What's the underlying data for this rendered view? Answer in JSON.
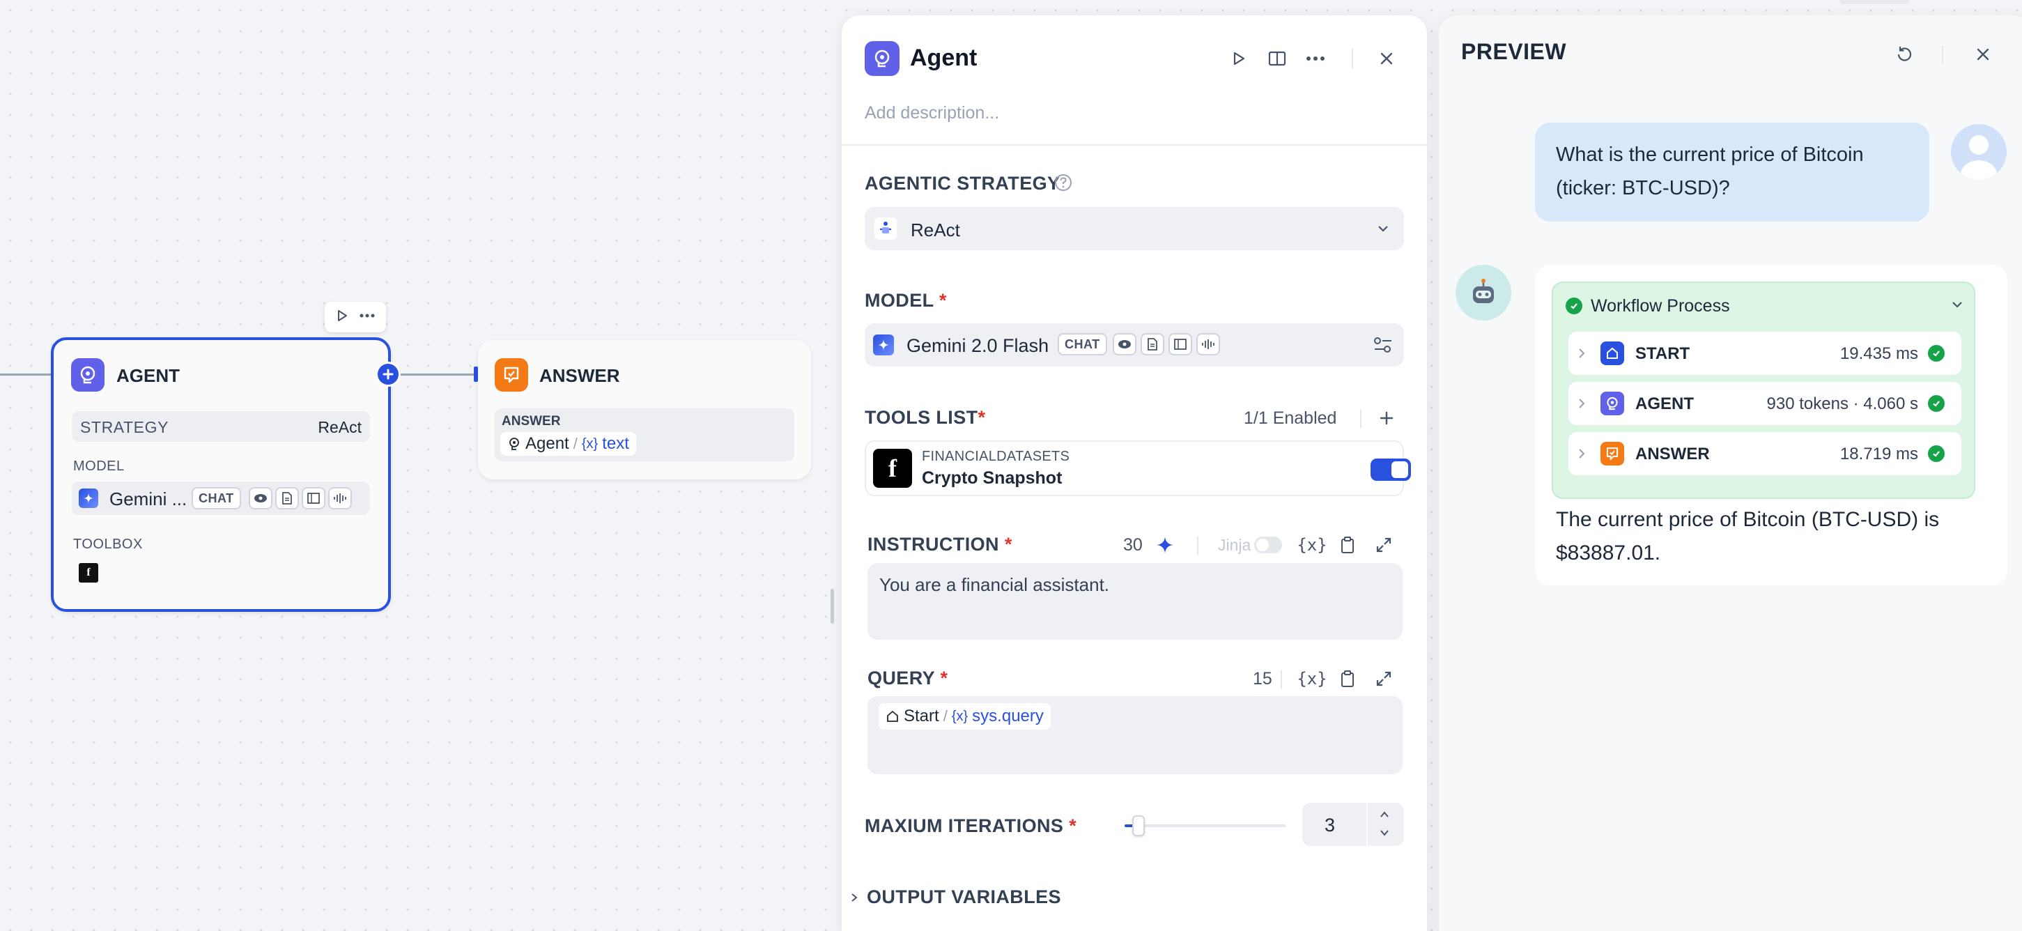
{
  "canvas": {
    "agent_node": {
      "title": "AGENT",
      "strategy_label": "STRATEGY",
      "strategy_value": "ReAct",
      "model_label": "MODEL",
      "model_name": "Gemini ...",
      "model_chip": "CHAT",
      "toolbox_label": "TOOLBOX",
      "toolbox_icon": "f"
    },
    "answer_node": {
      "title": "ANSWER",
      "answer_label": "ANSWER",
      "var_source": "Agent",
      "var_separator": "/",
      "var_name": "text"
    }
  },
  "agent_panel": {
    "title": "Agent",
    "description_placeholder": "Add description...",
    "strategy": {
      "label": "AGENTIC STRATEGY",
      "value": "ReAct"
    },
    "model": {
      "label": "MODEL",
      "required": "*",
      "name": "Gemini 2.0 Flash",
      "chip": "CHAT"
    },
    "tools": {
      "label": "TOOLS LIST",
      "required": "*",
      "enabled_count": "1/1 Enabled",
      "items": [
        {
          "provider": "FINANCIALDATASETS",
          "name": "Crypto Snapshot",
          "logo": "f",
          "enabled": true
        }
      ]
    },
    "instruction": {
      "label": "INSTRUCTION",
      "required": "*",
      "count": "30",
      "jinja_label": "Jinja",
      "text": "You are a financial assistant."
    },
    "query": {
      "label": "QUERY",
      "required": "*",
      "count": "15",
      "var_source": "Start",
      "var_separator": "/",
      "var_name": "sys.query"
    },
    "iterations": {
      "label": "MAXIUM ITERATIONS",
      "required": "*",
      "value": "3",
      "slider_fraction": 0.05
    },
    "output_variables": {
      "label": "OUTPUT VARIABLES"
    }
  },
  "preview": {
    "title": "PREVIEW",
    "user_message": "What is the current price of Bitcoin (ticker: BTC-USD)?",
    "workflow": {
      "title": "Workflow Process",
      "steps": [
        {
          "name": "START",
          "meta": "19.435 ms",
          "color": "#2a50e0"
        },
        {
          "name": "AGENT",
          "meta": "930 tokens · 4.060 s",
          "color": "#6160e8"
        },
        {
          "name": "ANSWER",
          "meta": "18.719 ms",
          "color": "#f47a16"
        }
      ]
    },
    "answer": "The current price of Bitcoin (BTC-USD) is $83887.01."
  },
  "colors": {
    "accent": "#2a50e0",
    "agent_icon": "#6160e8",
    "answer_icon": "#f47a16",
    "success": "#16a34a",
    "required": "#e0352b"
  }
}
